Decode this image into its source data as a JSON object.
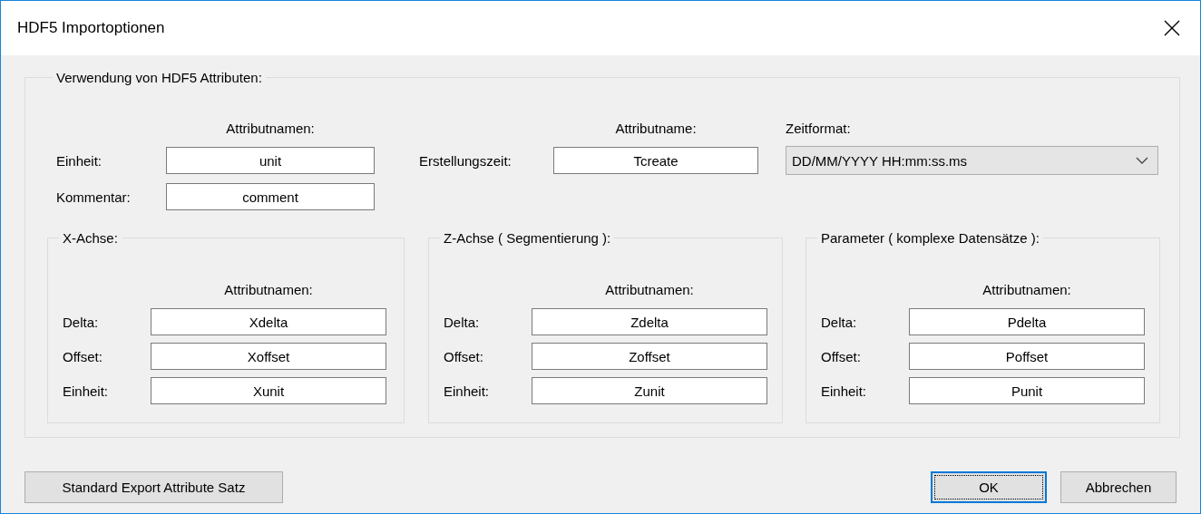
{
  "window": {
    "title": "HDF5 Importoptionen"
  },
  "attributes": {
    "legend": "Verwendung von HDF5 Attributen:",
    "header": "Attributnamen:",
    "rows": [
      {
        "label": "Einheit:",
        "value": "unit"
      },
      {
        "label": "Kommentar:",
        "value": "comment"
      }
    ],
    "creation": {
      "header": "Attributname:",
      "label": "Erstellungszeit:",
      "value": "Tcreate"
    },
    "time_format": {
      "label": "Zeitformat:",
      "value": "DD/MM/YYYY HH:mm:ss.ms"
    },
    "axes": [
      {
        "legend": "X-Achse:",
        "header": "Attributnamen:",
        "rows": [
          {
            "label": "Delta:",
            "value": "Xdelta"
          },
          {
            "label": "Offset:",
            "value": "Xoffset"
          },
          {
            "label": "Einheit:",
            "value": "Xunit"
          }
        ]
      },
      {
        "legend": "Z-Achse ( Segmentierung ):",
        "header": "Attributnamen:",
        "rows": [
          {
            "label": "Delta:",
            "value": "Zdelta"
          },
          {
            "label": "Offset:",
            "value": "Zoffset"
          },
          {
            "label": "Einheit:",
            "value": "Zunit"
          }
        ]
      },
      {
        "legend": "Parameter ( komplexe Datensätze ):",
        "header": "Attributnamen:",
        "rows": [
          {
            "label": "Delta:",
            "value": "Pdelta"
          },
          {
            "label": "Offset:",
            "value": "Poffset"
          },
          {
            "label": "Einheit:",
            "value": "Punit"
          }
        ]
      }
    ]
  },
  "left_buttons": [
    {
      "label": "Standard Export Attribute Satz",
      "focused": false
    }
  ],
  "right_buttons": [
    {
      "label": "OK",
      "focused": true
    },
    {
      "label": "Abbrechen",
      "focused": false
    }
  ]
}
